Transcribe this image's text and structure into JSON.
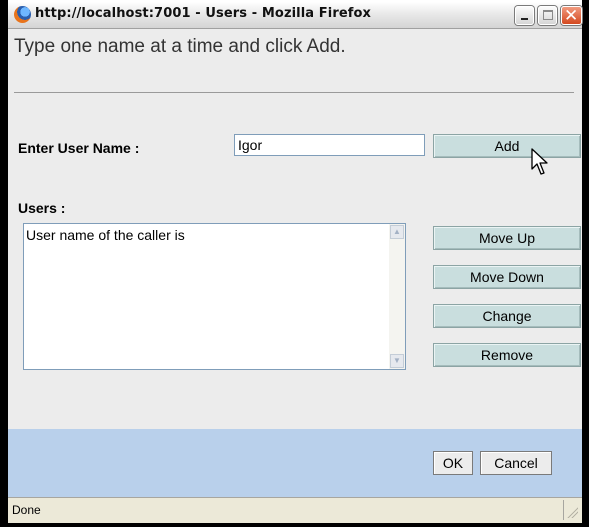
{
  "window": {
    "title": "http://localhost:7001 - Users - Mozilla Firefox",
    "app_icon": "firefox-icon"
  },
  "form": {
    "instruction": "Type one name at a time and click Add.",
    "user_name_label": "Enter User Name :",
    "user_name_value": "Igor",
    "add_label": "Add",
    "users_label": "Users :",
    "users": [
      "User name of the caller is"
    ],
    "move_up_label": "Move Up",
    "move_down_label": "Move Down",
    "change_label": "Change",
    "remove_label": "Remove"
  },
  "footer": {
    "ok_label": "OK",
    "cancel_label": "Cancel"
  },
  "status": {
    "text": "Done"
  },
  "colors": {
    "button_face": "#c9dede",
    "footer_bg": "#b9d0eb",
    "close_button": "#d4491f"
  }
}
